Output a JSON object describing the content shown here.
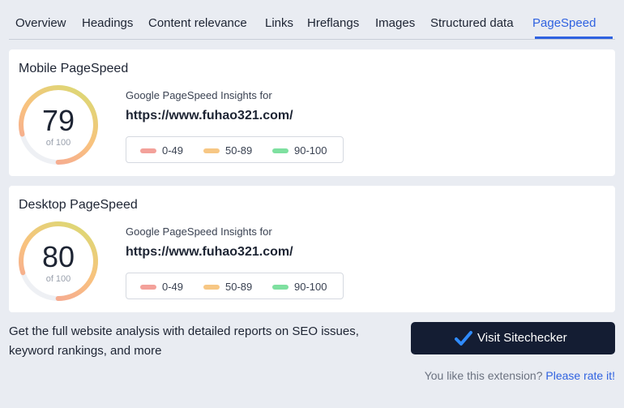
{
  "tabs": [
    {
      "label": "Overview",
      "active": false
    },
    {
      "label": "Headings",
      "active": false
    },
    {
      "label": "Content relevance",
      "active": false
    },
    {
      "label": "Links",
      "active": false
    },
    {
      "label": "Hreflangs",
      "active": false
    },
    {
      "label": "Images",
      "active": false
    },
    {
      "label": "Structured data",
      "active": false
    },
    {
      "label": "PageSpeed",
      "active": true
    }
  ],
  "mobile": {
    "title": "Mobile PageSpeed",
    "score": "79",
    "score_value": 79,
    "of_label": "of 100",
    "insights_label": "Google PageSpeed Insights for",
    "url": "https://www.fuhao321.com/"
  },
  "desktop": {
    "title": "Desktop PageSpeed",
    "score": "80",
    "score_value": 80,
    "of_label": "of 100",
    "insights_label": "Google PageSpeed Insights for",
    "url": "https://www.fuhao321.com/"
  },
  "legend": [
    {
      "label": "0-49",
      "color": "#f3a19a"
    },
    {
      "label": "50-89",
      "color": "#f7c784"
    },
    {
      "label": "90-100",
      "color": "#7ee0a0"
    }
  ],
  "promo": {
    "text": "Get the full website analysis with detailed reports on SEO issues, keyword rankings, and more",
    "button_label": "Visit Sitechecker",
    "button_icon": "check-icon"
  },
  "rate": {
    "prompt": "You like this extension?",
    "link": "Please rate it!"
  },
  "colors": {
    "accent": "#2f62e0",
    "button_bg": "#141d33",
    "gauge_track": "#eef0f4",
    "gauge_start": "#d6dd72",
    "gauge_mid": "#f9c27e",
    "gauge_end": "#f4a09a"
  }
}
